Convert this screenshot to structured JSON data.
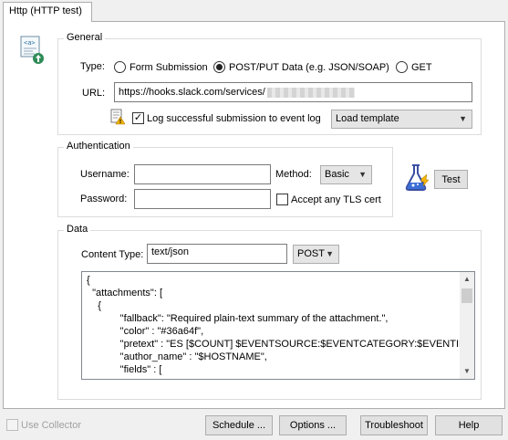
{
  "tab": {
    "label": "Http (HTTP test)"
  },
  "icons": {
    "page": "web-page-upload-icon",
    "test": "lab-flask-icon",
    "log": "log-warning-icon"
  },
  "general": {
    "legend": "General",
    "type_label": "Type:",
    "type_options": [
      "Form Submission",
      "POST/PUT Data (e.g. JSON/SOAP)",
      "GET"
    ],
    "type_selected": "POST/PUT Data (e.g. JSON/SOAP)",
    "url_label": "URL:",
    "url_value": "https://hooks.slack.com/services/",
    "log_label": "Log successful submission to event log",
    "log_checked": true,
    "template_select": "Load template"
  },
  "auth": {
    "legend": "Authentication",
    "username_label": "Username:",
    "username_value": "",
    "password_label": "Password:",
    "password_value": "",
    "method_label": "Method:",
    "method_value": "Basic",
    "tls_label": "Accept any TLS cert",
    "tls_checked": false,
    "test_button": "Test"
  },
  "data": {
    "legend": "Data",
    "content_type_label": "Content Type:",
    "content_type_value": "text/json",
    "http_method": "POST",
    "body_lines": [
      "{",
      "  \"attachments\": [",
      "    {",
      "            \"fallback\": \"Required plain-text summary of the attachment.\",",
      "            \"color\" : \"#36a64f\",",
      "            \"pretext\" : \"ES [$COUNT] $EVENTSOURCE:$EVENTCATEGORY:$EVENTID\",",
      "            \"author_name\" : \"$HOSTNAME\",",
      "            \"fields\" : ["
    ]
  },
  "footer": {
    "use_collector": "Use Collector",
    "schedule": "Schedule ...",
    "options": "Options ...",
    "troubleshoot": "Troubleshoot",
    "help": "Help"
  }
}
